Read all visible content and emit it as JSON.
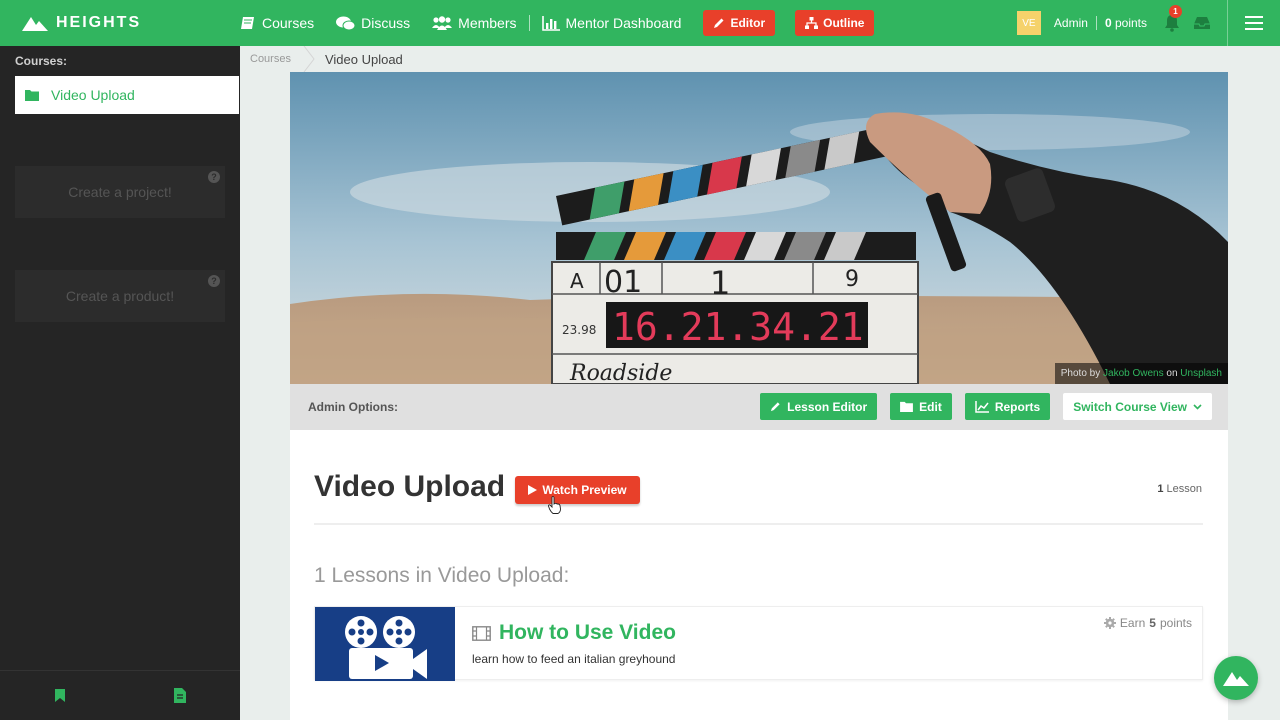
{
  "header": {
    "brand": "HEIGHTS",
    "nav": {
      "courses": "Courses",
      "discuss": "Discuss",
      "members": "Members",
      "mentor": "Mentor Dashboard"
    },
    "editor_label": "Editor",
    "outline_label": "Outline",
    "avatar_initials": "VE",
    "user_name": "Admin",
    "points_value": "0",
    "points_label": "points",
    "notification_count": "1"
  },
  "sidebar": {
    "title": "Courses:",
    "active_course": "Video Upload",
    "project_card": "Create a project!",
    "product_card": "Create a product!",
    "help_glyph": "?"
  },
  "breadcrumb": {
    "root": "Courses",
    "current": "Video Upload"
  },
  "hero": {
    "credit_prefix": "Photo by",
    "credit_author": "Jakob Owens",
    "credit_mid": "on",
    "credit_site": "Unsplash",
    "slate": {
      "roll": "A",
      "roll_num": "01",
      "scene": "1",
      "take": "9",
      "fps": "23.98",
      "timecode": "16.21.34.21",
      "title": "Roadside"
    }
  },
  "admin": {
    "label": "Admin Options:",
    "lesson_editor": "Lesson Editor",
    "edit": "Edit",
    "reports": "Reports",
    "switch_view": "Switch Course View"
  },
  "course": {
    "title": "Video Upload",
    "watch_preview": "Watch Preview",
    "lesson_count": "1",
    "lesson_count_label": "Lesson",
    "section_heading": "1 Lessons in Video Upload:"
  },
  "lessons": [
    {
      "title": "How to Use Video",
      "description": "learn how to feed an italian greyhound",
      "points_prefix": "Earn",
      "points": "5",
      "points_suffix": "points"
    }
  ],
  "colors": {
    "brand": "#31b55f",
    "accent": "#e8402a",
    "sidebar": "#252525",
    "thumb": "#173e86"
  }
}
